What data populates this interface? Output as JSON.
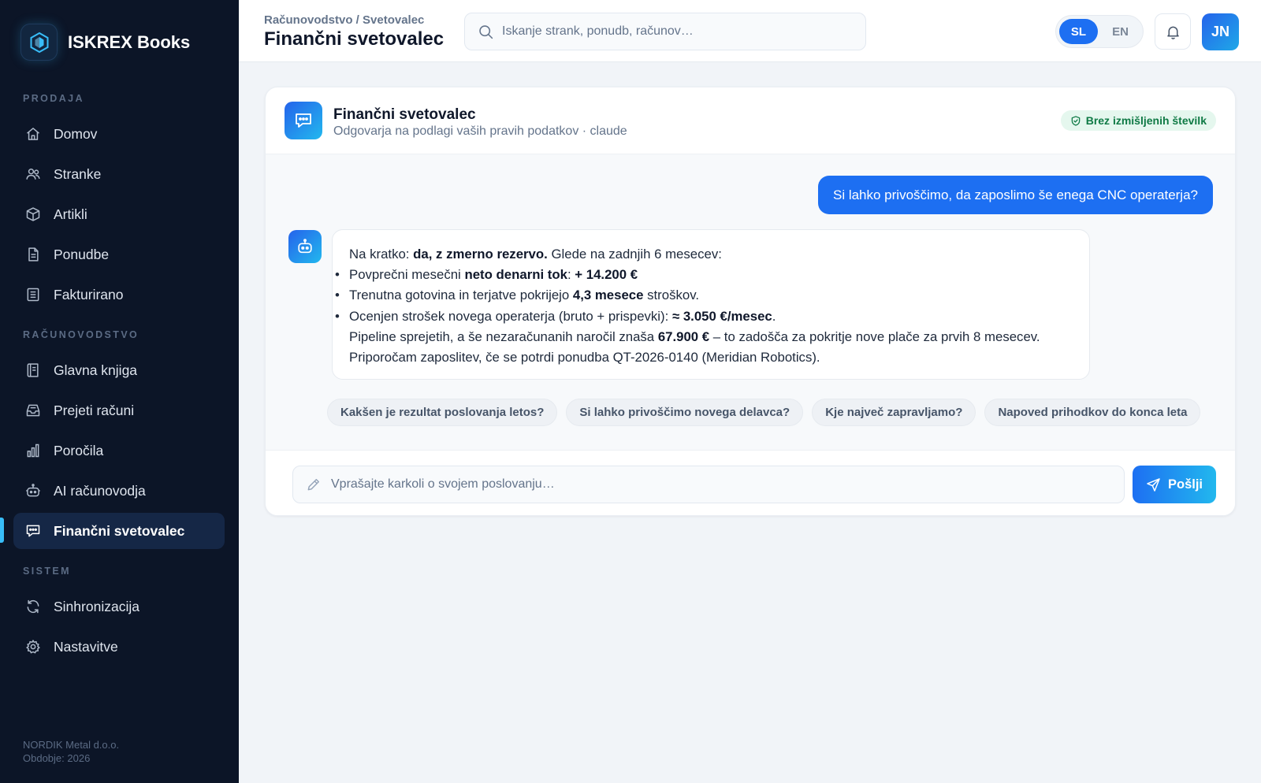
{
  "brand": {
    "name": "ISKREX Books",
    "logo_icon": "hexagon-logo-icon"
  },
  "sidebar": {
    "sections": {
      "sales": "PRODAJA",
      "accounting": "RAČUNOVODSTVO",
      "system": "SISTEM"
    },
    "items": [
      {
        "label": "Domov",
        "icon": "home-icon"
      },
      {
        "label": "Stranke",
        "icon": "users-icon"
      },
      {
        "label": "Artikli",
        "icon": "box-icon"
      },
      {
        "label": "Ponudbe",
        "icon": "document-icon"
      },
      {
        "label": "Fakturirano",
        "icon": "invoice-icon"
      },
      {
        "label": "Glavna knjiga",
        "icon": "ledger-icon"
      },
      {
        "label": "Prejeti računi",
        "icon": "inbox-icon"
      },
      {
        "label": "Poročila",
        "icon": "bar-chart-icon"
      },
      {
        "label": "AI računovodja",
        "icon": "robot-icon"
      },
      {
        "label": "Finančni svetovalec",
        "icon": "chat-icon",
        "active": true
      },
      {
        "label": "Sinhronizacija",
        "icon": "sync-icon"
      },
      {
        "label": "Nastavitve",
        "icon": "gear-icon"
      }
    ],
    "footer": {
      "company": "NORDIK Metal d.o.o.",
      "period": "Obdobje: 2026"
    }
  },
  "header": {
    "breadcrumb": "Računovodstvo / Svetovalec",
    "title": "Finančni svetovalec",
    "search_placeholder": "Iskanje strank, ponudb, računov…",
    "languages": [
      {
        "code": "SL",
        "active": true
      },
      {
        "code": "EN",
        "active": false
      }
    ],
    "avatar_initials": "JN"
  },
  "chat": {
    "title": "Finančni svetovalec",
    "subtitle": "Odgovarja na podlagi vaših pravih podatkov · claude",
    "badge": "Brez izmišljenih številk",
    "user_message": "Si lahko privoščimo, da zaposlimo še enega CNC operaterja?",
    "assistant": {
      "intro_prefix": "Na kratko: ",
      "intro_bold": "da, z zmerno rezervo.",
      "intro_suffix": " Glede na zadnjih 6 mesecev:",
      "b1_prefix": "Povprečni mesečni ",
      "b1_bold1": "neto denarni tok",
      "b1_mid": ": ",
      "b1_bold2": "+ 14.200 €",
      "b2_prefix": "Trenutna gotovina in terjatve pokrijejo ",
      "b2_bold": "4,3 mesece",
      "b2_suffix": " stroškov.",
      "b3_prefix": "Ocenjen strošek novega operaterja (bruto + prispevki): ",
      "b3_bold": "≈ 3.050 €/mesec",
      "b3_suffix": ".",
      "p1_prefix": "Pipeline sprejetih, a še nezaračunanih naročil znaša ",
      "p1_bold": "67.900 €",
      "p1_suffix": " – to zadošča za pokritje nove plače za prvih 8 mesecev.",
      "p2": "Priporočam zaposlitev, če se potrdi ponudba QT-2026-0140 (Meridian Robotics)."
    },
    "suggestions": [
      "Kakšen je rezultat poslovanja letos?",
      "Si lahko privoščimo novega delavca?",
      "Kje največ zapravljamo?",
      "Napoved prihodkov do konca leta"
    ],
    "input_placeholder": "Vprašajte karkoli o svojem poslovanju…",
    "send_label": "Pošlji"
  },
  "colors": {
    "accent": "#1d6ff2",
    "sidebar_bg": "#0c1527",
    "badge_green": "#0f7a45"
  }
}
